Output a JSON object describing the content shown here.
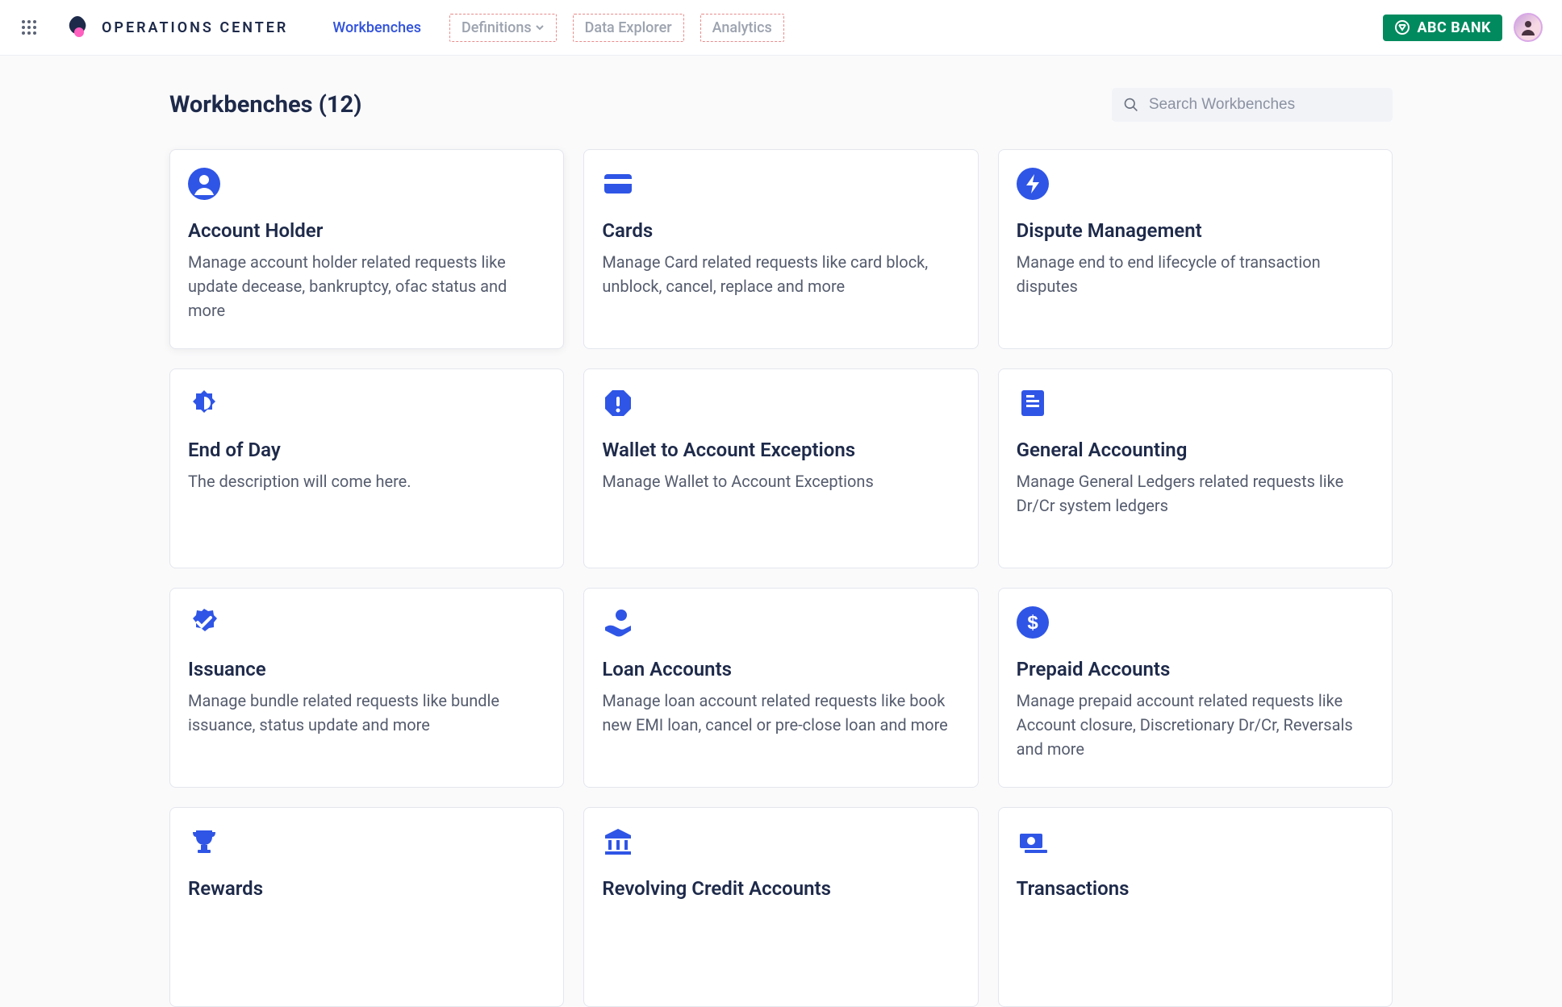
{
  "brand": {
    "name": "OPERATIONS CENTER"
  },
  "nav": {
    "items": [
      {
        "label": "Workbenches",
        "active": true,
        "dashed": false
      },
      {
        "label": "Definitions",
        "active": false,
        "dashed": true,
        "dropdown": true
      },
      {
        "label": "Data Explorer",
        "active": false,
        "dashed": true
      },
      {
        "label": "Analytics",
        "active": false,
        "dashed": true
      }
    ]
  },
  "tenant": {
    "label": "ABC BANK"
  },
  "page": {
    "title_prefix": "Workbenches",
    "count": 12
  },
  "search": {
    "placeholder": "Search Workbenches",
    "value": ""
  },
  "cards": [
    {
      "icon": "person-circle",
      "title": "Account Holder",
      "desc": "Manage account holder related requests like update decease, bankruptcy, ofac status and more"
    },
    {
      "icon": "credit-card",
      "title": "Cards",
      "desc": "Manage Card related requests like card block, unblock, cancel, replace and more"
    },
    {
      "icon": "bolt-circle",
      "title": "Dispute Management",
      "desc": "Manage end to end lifecycle of transaction disputes"
    },
    {
      "icon": "brightness",
      "title": "End of Day",
      "desc": "The description will come here."
    },
    {
      "icon": "alert-octagon",
      "title": "Wallet to Account Exceptions",
      "desc": "Manage Wallet to Account Exceptions"
    },
    {
      "icon": "ledger",
      "title": "General Accounting",
      "desc": "Manage General Ledgers related requests like Dr/Cr system ledgers"
    },
    {
      "icon": "verified",
      "title": "Issuance",
      "desc": "Manage bundle related requests like bundle issuance, status update and more"
    },
    {
      "icon": "hand-coin",
      "title": "Loan Accounts",
      "desc": "Manage loan account related requests like book new EMI loan, cancel or pre-close loan and more"
    },
    {
      "icon": "dollar-circle",
      "title": "Prepaid Accounts",
      "desc": "Manage prepaid account related requests like Account closure, Discretionary Dr/Cr, Reversals and more"
    },
    {
      "icon": "trophy",
      "title": "Rewards",
      "desc": ""
    },
    {
      "icon": "bank",
      "title": "Revolving Credit Accounts",
      "desc": ""
    },
    {
      "icon": "cash",
      "title": "Transactions",
      "desc": ""
    }
  ],
  "colors": {
    "accent": "#2f55e6",
    "tenant": "#008a5e"
  }
}
